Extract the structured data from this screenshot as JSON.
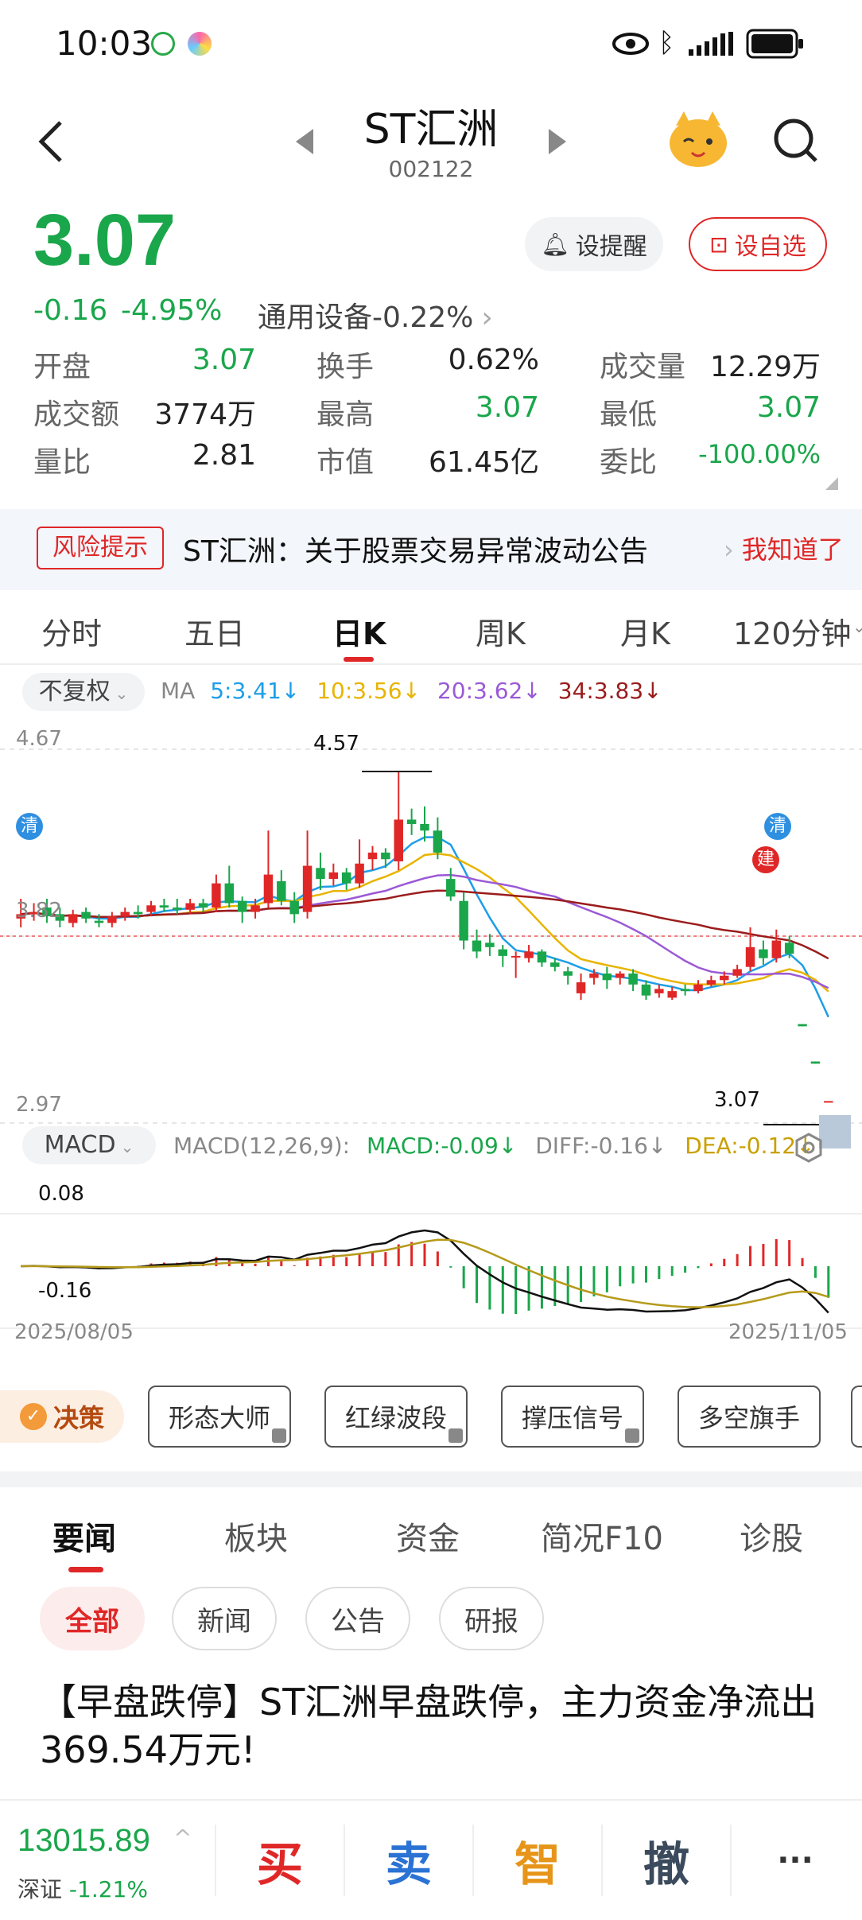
{
  "status_bar": {
    "time": "10:03",
    "icons": [
      "wechat-icon",
      "app-icon",
      "eye-icon",
      "bluetooth-icon",
      "signal-icon",
      "battery-icon"
    ]
  },
  "header": {
    "stock_name": "ST汇洲",
    "stock_code": "002122"
  },
  "quote": {
    "price": "3.07",
    "change": "-0.16",
    "change_pct": "-4.95%",
    "sector": "通用设备-0.22%",
    "alert_button": "设提醒",
    "watch_button": "设自选",
    "colors": {
      "up": "#e02727",
      "down": "#1aa64b"
    }
  },
  "stats": [
    [
      {
        "label": "开盘",
        "value": "3.07",
        "color": "green"
      },
      {
        "label": "换手",
        "value": "0.62%",
        "color": "black"
      },
      {
        "label": "成交量",
        "value": "12.29万",
        "color": "black"
      }
    ],
    [
      {
        "label": "成交额",
        "value": "3774万",
        "color": "black"
      },
      {
        "label": "最高",
        "value": "3.07",
        "color": "green"
      },
      {
        "label": "最低",
        "value": "3.07",
        "color": "green"
      }
    ],
    [
      {
        "label": "量比",
        "value": "2.81",
        "color": "black"
      },
      {
        "label": "市值",
        "value": "61.45亿",
        "color": "black"
      },
      {
        "label": "委比",
        "value": "-100.00%",
        "color": "green"
      }
    ]
  ],
  "risk": {
    "tag": "风险提示",
    "text": "ST汇洲：关于股票交易异常波动公告",
    "action": "我知道了"
  },
  "period_tabs": [
    "分时",
    "五日",
    "日K",
    "周K",
    "月K",
    "120分钟"
  ],
  "active_period": "日K",
  "kline": {
    "adjust": "不复权",
    "ma_title": "MA",
    "ma": [
      {
        "label": "5:3.41↓",
        "color": "#1e9ee8"
      },
      {
        "label": "10:3.56↓",
        "color": "#e8b400"
      },
      {
        "label": "20:3.62↓",
        "color": "#9b59d6"
      },
      {
        "label": "34:3.83↓",
        "color": "#9b1c1c"
      }
    ],
    "y_top": "4.67",
    "y_mid": "3.82",
    "y_bottom": "2.97",
    "high_label": "4.57",
    "last_label": "3.07",
    "marker_qing": "清",
    "marker_jian": "建"
  },
  "macd": {
    "name": "MACD",
    "params": "MACD(12,26,9):",
    "macd": "MACD:-0.09↓",
    "diff": "DIFF:-0.16↓",
    "dea": "DEA:-0.12↓",
    "y_top": "0.08",
    "y_bottom": "-0.16",
    "date_start": "2025/08/05",
    "date_end": "2025/11/05"
  },
  "features": {
    "decision": "决策",
    "buttons": [
      "形态大师",
      "红绿波段",
      "撑压信号",
      "多空旗手"
    ]
  },
  "news_tabs": [
    "要闻",
    "板块",
    "资金",
    "简况F10",
    "诊股"
  ],
  "news_filters": [
    "全部",
    "新闻",
    "公告",
    "研报"
  ],
  "headline": "【早盘跌停】ST汇洲早盘跌停，主力资金净流出369.54万元!",
  "index": {
    "value": "13015.89",
    "name": "深证",
    "change": "-1.21%"
  },
  "actions": [
    "买",
    "卖",
    "智",
    "撤",
    "···"
  ],
  "chart_data": {
    "type": "candlestick",
    "x_range": [
      "2025/08/05",
      "2025/11/05"
    ],
    "ylim": [
      2.97,
      4.67
    ],
    "candles": [
      {
        "o": 3.9,
        "c": 3.92,
        "h": 3.99,
        "l": 3.86
      },
      {
        "o": 3.92,
        "c": 3.93,
        "h": 3.97,
        "l": 3.89
      },
      {
        "o": 3.95,
        "c": 3.91,
        "h": 3.99,
        "l": 3.88
      },
      {
        "o": 3.92,
        "c": 3.89,
        "h": 3.95,
        "l": 3.86
      },
      {
        "o": 3.88,
        "c": 3.92,
        "h": 3.94,
        "l": 3.86
      },
      {
        "o": 3.93,
        "c": 3.9,
        "h": 3.95,
        "l": 3.88
      },
      {
        "o": 3.89,
        "c": 3.88,
        "h": 3.92,
        "l": 3.86
      },
      {
        "o": 3.88,
        "c": 3.91,
        "h": 3.93,
        "l": 3.86
      },
      {
        "o": 3.91,
        "c": 3.93,
        "h": 3.95,
        "l": 3.89
      },
      {
        "o": 3.93,
        "c": 3.92,
        "h": 3.96,
        "l": 3.9
      },
      {
        "o": 3.93,
        "c": 3.96,
        "h": 3.98,
        "l": 3.91
      },
      {
        "o": 3.96,
        "c": 3.95,
        "h": 3.99,
        "l": 3.93
      },
      {
        "o": 3.95,
        "c": 3.94,
        "h": 3.99,
        "l": 3.92
      },
      {
        "o": 3.94,
        "c": 3.97,
        "h": 3.99,
        "l": 3.92
      },
      {
        "o": 3.97,
        "c": 3.95,
        "h": 3.99,
        "l": 3.93
      },
      {
        "o": 3.95,
        "c": 4.06,
        "h": 4.1,
        "l": 3.93
      },
      {
        "o": 4.06,
        "c": 3.97,
        "h": 4.14,
        "l": 3.95
      },
      {
        "o": 3.98,
        "c": 3.93,
        "h": 4.0,
        "l": 3.88
      },
      {
        "o": 3.93,
        "c": 3.96,
        "h": 3.99,
        "l": 3.9
      },
      {
        "o": 3.97,
        "c": 4.1,
        "h": 4.3,
        "l": 3.95
      },
      {
        "o": 4.07,
        "c": 3.98,
        "h": 4.12,
        "l": 3.96
      },
      {
        "o": 3.98,
        "c": 3.92,
        "h": 4.02,
        "l": 3.88
      },
      {
        "o": 3.93,
        "c": 4.14,
        "h": 4.3,
        "l": 3.9
      },
      {
        "o": 4.13,
        "c": 4.08,
        "h": 4.2,
        "l": 4.03
      },
      {
        "o": 4.08,
        "c": 4.11,
        "h": 4.15,
        "l": 4.05
      },
      {
        "o": 4.11,
        "c": 4.06,
        "h": 4.13,
        "l": 4.03
      },
      {
        "o": 4.06,
        "c": 4.15,
        "h": 4.26,
        "l": 4.04
      },
      {
        "o": 4.17,
        "c": 4.2,
        "h": 4.23,
        "l": 4.12
      },
      {
        "o": 4.2,
        "c": 4.17,
        "h": 4.22,
        "l": 4.13
      },
      {
        "o": 4.16,
        "c": 4.35,
        "h": 4.57,
        "l": 4.12
      },
      {
        "o": 4.35,
        "c": 4.33,
        "h": 4.4,
        "l": 4.28
      },
      {
        "o": 4.33,
        "c": 4.3,
        "h": 4.41,
        "l": 4.25
      },
      {
        "o": 4.3,
        "c": 4.2,
        "h": 4.36,
        "l": 4.17
      },
      {
        "o": 4.08,
        "c": 4.0,
        "h": 4.13,
        "l": 3.98
      },
      {
        "o": 3.98,
        "c": 3.8,
        "h": 4.02,
        "l": 3.76
      },
      {
        "o": 3.8,
        "c": 3.75,
        "h": 3.85,
        "l": 3.72
      },
      {
        "o": 3.79,
        "c": 3.77,
        "h": 3.83,
        "l": 3.73
      },
      {
        "o": 3.76,
        "c": 3.73,
        "h": 3.78,
        "l": 3.68
      },
      {
        "o": 3.73,
        "c": 3.73,
        "h": 3.75,
        "l": 3.63
      },
      {
        "o": 3.72,
        "c": 3.75,
        "h": 3.78,
        "l": 3.7
      },
      {
        "o": 3.75,
        "c": 3.7,
        "h": 3.76,
        "l": 3.68
      },
      {
        "o": 3.7,
        "c": 3.68,
        "h": 3.72,
        "l": 3.66
      },
      {
        "o": 3.66,
        "c": 3.64,
        "h": 3.68,
        "l": 3.6
      },
      {
        "o": 3.56,
        "c": 3.61,
        "h": 3.65,
        "l": 3.53
      },
      {
        "o": 3.63,
        "c": 3.65,
        "h": 3.67,
        "l": 3.6
      },
      {
        "o": 3.65,
        "c": 3.62,
        "h": 3.68,
        "l": 3.58
      },
      {
        "o": 3.63,
        "c": 3.65,
        "h": 3.66,
        "l": 3.6
      },
      {
        "o": 3.65,
        "c": 3.6,
        "h": 3.67,
        "l": 3.57
      },
      {
        "o": 3.6,
        "c": 3.55,
        "h": 3.62,
        "l": 3.53
      },
      {
        "o": 3.56,
        "c": 3.58,
        "h": 3.6,
        "l": 3.54
      },
      {
        "o": 3.54,
        "c": 3.57,
        "h": 3.59,
        "l": 3.53
      },
      {
        "o": 3.58,
        "c": 3.57,
        "h": 3.6,
        "l": 3.55
      },
      {
        "o": 3.57,
        "c": 3.6,
        "h": 3.62,
        "l": 3.56
      },
      {
        "o": 3.6,
        "c": 3.62,
        "h": 3.64,
        "l": 3.59
      },
      {
        "o": 3.62,
        "c": 3.64,
        "h": 3.66,
        "l": 3.6
      },
      {
        "o": 3.64,
        "c": 3.67,
        "h": 3.69,
        "l": 3.63
      },
      {
        "o": 3.68,
        "c": 3.77,
        "h": 3.86,
        "l": 3.66
      },
      {
        "o": 3.76,
        "c": 3.72,
        "h": 3.8,
        "l": 3.69
      },
      {
        "o": 3.72,
        "c": 3.8,
        "h": 3.85,
        "l": 3.7
      },
      {
        "o": 3.79,
        "c": 3.74,
        "h": 3.82,
        "l": 3.72
      },
      {
        "o": 3.42,
        "c": 3.41,
        "h": 3.42,
        "l": 3.41
      },
      {
        "o": 3.25,
        "c": 3.24,
        "h": 3.25,
        "l": 3.24
      },
      {
        "o": 3.07,
        "c": 3.07,
        "h": 3.07,
        "l": 3.07
      }
    ]
  }
}
